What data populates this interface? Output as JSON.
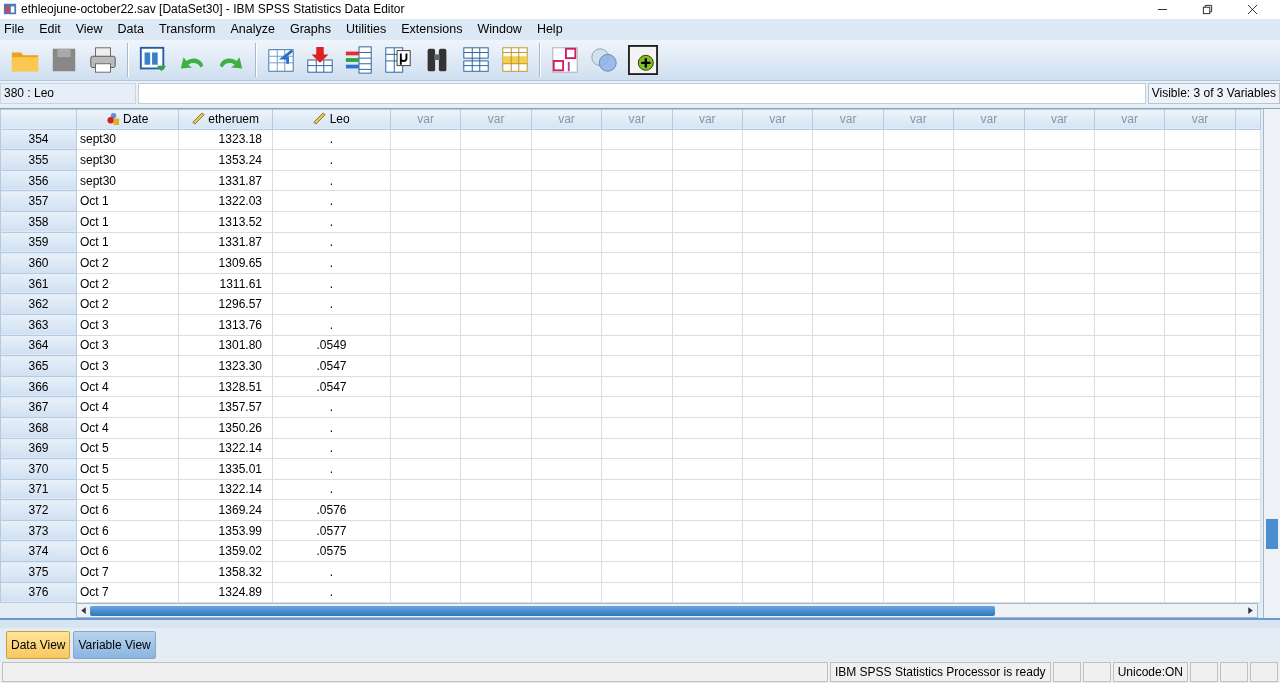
{
  "window": {
    "title": "ethleojune-october22.sav [DataSet30] - IBM SPSS Statistics Data Editor"
  },
  "menu": [
    "File",
    "Edit",
    "View",
    "Data",
    "Transform",
    "Analyze",
    "Graphs",
    "Utilities",
    "Extensions",
    "Window",
    "Help"
  ],
  "cell_editor": {
    "cell_ref": "380 : Leo"
  },
  "visible_info": "Visible: 3 of 3 Variables",
  "table": {
    "columns": [
      {
        "name": "Date",
        "kind": "nominal"
      },
      {
        "name": "etheruem",
        "kind": "scale"
      },
      {
        "name": "Leo",
        "kind": "scale"
      },
      {
        "name": "var",
        "kind": "empty"
      },
      {
        "name": "var",
        "kind": "empty"
      },
      {
        "name": "var",
        "kind": "empty"
      },
      {
        "name": "var",
        "kind": "empty"
      },
      {
        "name": "var",
        "kind": "empty"
      },
      {
        "name": "var",
        "kind": "empty"
      },
      {
        "name": "var",
        "kind": "empty"
      },
      {
        "name": "var",
        "kind": "empty"
      },
      {
        "name": "var",
        "kind": "empty"
      },
      {
        "name": "var",
        "kind": "empty"
      },
      {
        "name": "var",
        "kind": "empty"
      },
      {
        "name": "var",
        "kind": "empty"
      }
    ],
    "rows": [
      {
        "n": "354",
        "cells": [
          "sept30",
          "1323.18",
          "."
        ]
      },
      {
        "n": "355",
        "cells": [
          "sept30",
          "1353.24",
          "."
        ]
      },
      {
        "n": "356",
        "cells": [
          "sept30",
          "1331.87",
          "."
        ]
      },
      {
        "n": "357",
        "cells": [
          "Oct 1",
          "1322.03",
          "."
        ]
      },
      {
        "n": "358",
        "cells": [
          "Oct 1",
          "1313.52",
          "."
        ]
      },
      {
        "n": "359",
        "cells": [
          "Oct 1",
          "1331.87",
          "."
        ]
      },
      {
        "n": "360",
        "cells": [
          "Oct 2",
          "1309.65",
          "."
        ]
      },
      {
        "n": "361",
        "cells": [
          "Oct 2",
          "1311.61",
          "."
        ]
      },
      {
        "n": "362",
        "cells": [
          "Oct 2",
          "1296.57",
          "."
        ]
      },
      {
        "n": "363",
        "cells": [
          "Oct 3",
          "1313.76",
          "."
        ]
      },
      {
        "n": "364",
        "cells": [
          "Oct 3",
          "1301.80",
          ".0549"
        ]
      },
      {
        "n": "365",
        "cells": [
          "Oct 3",
          "1323.30",
          ".0547"
        ]
      },
      {
        "n": "366",
        "cells": [
          "Oct 4",
          "1328.51",
          ".0547"
        ]
      },
      {
        "n": "367",
        "cells": [
          "Oct 4",
          "1357.57",
          "."
        ]
      },
      {
        "n": "368",
        "cells": [
          "Oct 4",
          "1350.26",
          "."
        ]
      },
      {
        "n": "369",
        "cells": [
          "Oct 5",
          "1322.14",
          "."
        ]
      },
      {
        "n": "370",
        "cells": [
          "Oct 5",
          "1335.01",
          "."
        ]
      },
      {
        "n": "371",
        "cells": [
          "Oct 5",
          "1322.14",
          "."
        ]
      },
      {
        "n": "372",
        "cells": [
          "Oct 6",
          "1369.24",
          ".0576"
        ]
      },
      {
        "n": "373",
        "cells": [
          "Oct 6",
          "1353.99",
          ".0577"
        ]
      },
      {
        "n": "374",
        "cells": [
          "Oct 6",
          "1359.02",
          ".0575"
        ]
      },
      {
        "n": "375",
        "cells": [
          "Oct 7",
          "1358.32",
          "."
        ]
      },
      {
        "n": "376",
        "cells": [
          "Oct 7",
          "1324.89",
          "."
        ]
      }
    ]
  },
  "tabs": [
    {
      "label": "Data View",
      "selected": true
    },
    {
      "label": "Variable View",
      "selected": false
    }
  ],
  "status_bar": {
    "processor": "IBM SPSS Statistics Processor is ready",
    "unicode": "Unicode:ON"
  }
}
